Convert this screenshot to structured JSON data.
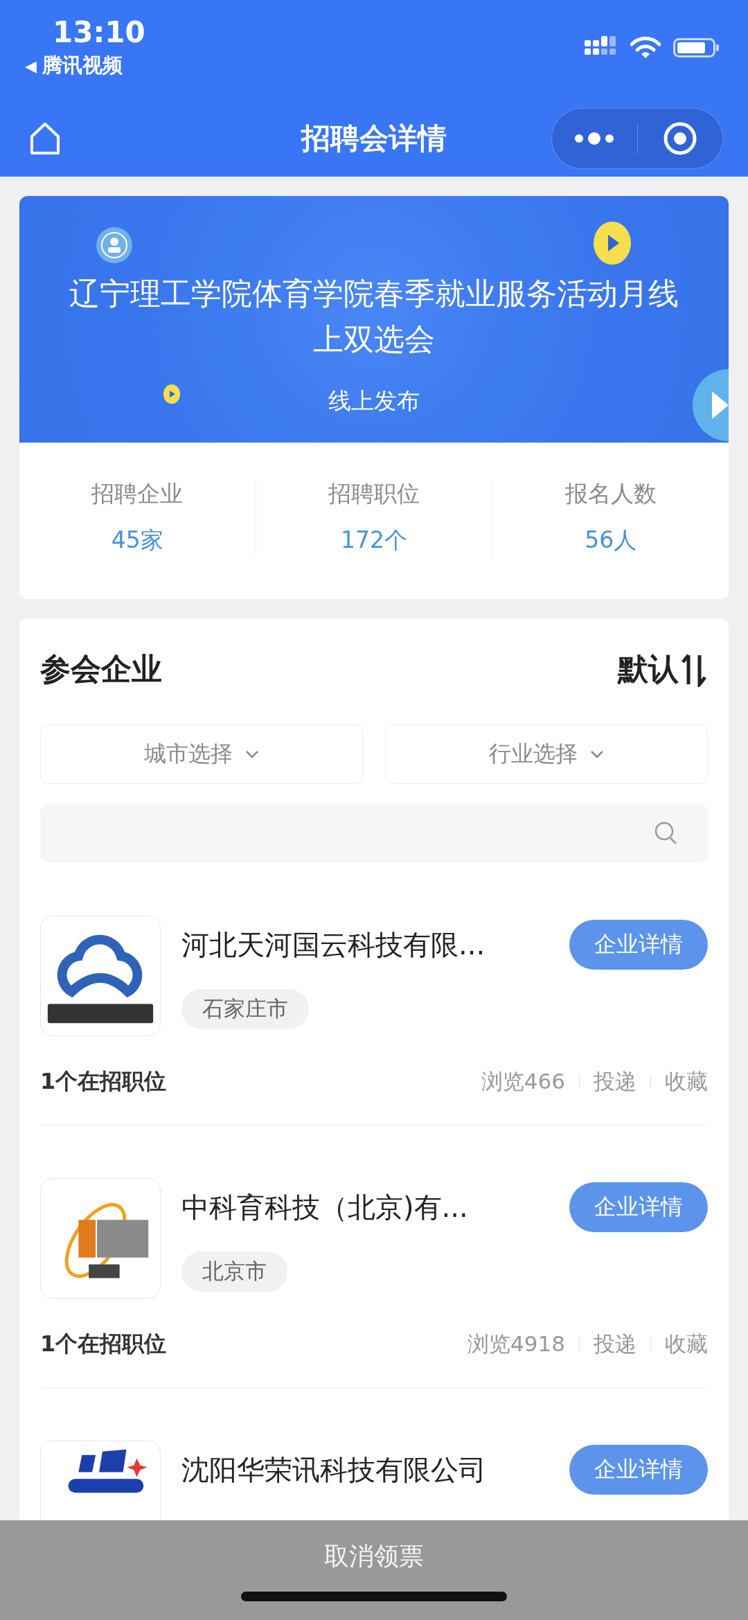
{
  "status_bar": {
    "time": "13:10",
    "back_arrow": "◀",
    "back_app": "腾讯视频"
  },
  "nav": {
    "title": "招聘会详情"
  },
  "banner": {
    "title": "辽宁理工学院体育学院春季就业服务活动月线上双选会",
    "subtitle": "线上发布"
  },
  "stats": [
    {
      "label": "招聘企业",
      "value": "45家"
    },
    {
      "label": "招聘职位",
      "value": "172个"
    },
    {
      "label": "报名人数",
      "value": "56人"
    }
  ],
  "section": {
    "title": "参会企业",
    "sort": "默认"
  },
  "filters": [
    {
      "label": "城市选择"
    },
    {
      "label": "行业选择"
    }
  ],
  "companies": [
    {
      "kind": "cloud",
      "name": "河北天河国云科技有限...",
      "tag": "石家庄市",
      "positions": "1个在招职位",
      "views": "浏览466",
      "actions": [
        "投递",
        "收藏"
      ],
      "button": "企业详情"
    },
    {
      "kind": "orbit",
      "name": "中科育科技（北京)有...",
      "tag": "北京市",
      "positions": "1个在招职位",
      "views": "浏览4918",
      "actions": [
        "投递",
        "收藏"
      ],
      "button": "企业详情"
    },
    {
      "kind": "bars",
      "name": "沈阳华荣讯科技有限公司",
      "button": "企业详情"
    }
  ],
  "bottom_bar": {
    "label": "取消领票"
  }
}
